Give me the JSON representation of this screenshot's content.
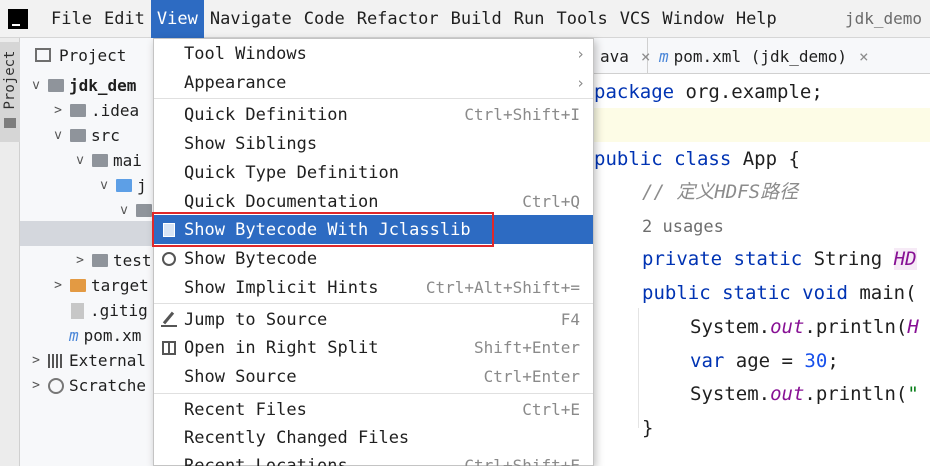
{
  "menubar": {
    "items": [
      "File",
      "Edit",
      "View",
      "Navigate",
      "Code",
      "Refactor",
      "Build",
      "Run",
      "Tools",
      "VCS",
      "Window",
      "Help"
    ],
    "active_index": 2,
    "project_title": "jdk_demo"
  },
  "left_stripe": {
    "project_label": "Project"
  },
  "project_panel": {
    "title": "Project",
    "tree": [
      {
        "label": "jdk_dem",
        "arrow": "v",
        "icon": "folder"
      },
      {
        "label": ".idea",
        "arrow": ">",
        "icon": "folder"
      },
      {
        "label": "src",
        "arrow": "v",
        "icon": "folder"
      },
      {
        "label": "mai",
        "arrow": "v",
        "icon": "folder"
      },
      {
        "label": "j",
        "arrow": "v",
        "icon": "folder-blue"
      },
      {
        "label": "",
        "arrow": "v",
        "icon": "package"
      },
      {
        "label": "",
        "arrow": "",
        "icon": ""
      },
      {
        "label": "test",
        "arrow": ">",
        "icon": "folder"
      },
      {
        "label": "target",
        "arrow": ">",
        "icon": "folder-orange"
      },
      {
        "label": ".gitig",
        "arrow": "",
        "icon": "file"
      },
      {
        "label": "pom.xm",
        "arrow": "",
        "icon": "maven"
      },
      {
        "label": "External",
        "arrow": ">",
        "icon": "libraries"
      },
      {
        "label": "Scratche",
        "arrow": ">",
        "icon": "scratches"
      }
    ]
  },
  "tabs": [
    {
      "label": "ava",
      "close": "×"
    },
    {
      "label": "pom.xml (jdk_demo)",
      "close": "×"
    }
  ],
  "code": {
    "package_kw": "package",
    "package_name": "org.example;",
    "class_decl_kw": "public class",
    "class_name": "App {",
    "comment": "// 定义HDFS路径",
    "usages": "2 usages",
    "field_kw": "private static",
    "field_type": "String",
    "field_name": "HD",
    "main_kw": "public static void",
    "main_name": "main(",
    "line1_prefix": "System.",
    "line1_out": "out",
    "line1_suffix": ".println(",
    "line1_arg": "H",
    "var_kw": "var",
    "var_rest": "age = ",
    "var_value": "30",
    "var_semicolon": ";",
    "line3_prefix": "System.",
    "line3_out": "out",
    "line3_suffix": ".println(",
    "line3_arg": "\"",
    "closing_brace": "}"
  },
  "view_menu": {
    "items": [
      {
        "label": "Tool Windows",
        "shortcut": "",
        "submenu": true
      },
      {
        "label": "Appearance",
        "shortcut": "",
        "submenu": true
      },
      {
        "label": "Quick Definition",
        "shortcut": "Ctrl+Shift+I"
      },
      {
        "label": "Show Siblings",
        "shortcut": ""
      },
      {
        "label": "Quick Type Definition",
        "shortcut": ""
      },
      {
        "label": "Quick Documentation",
        "shortcut": "Ctrl+Q"
      },
      {
        "label": "Show Bytecode With Jclasslib",
        "shortcut": "",
        "icon": "jclasslib-icon",
        "highlighted": true
      },
      {
        "label": "Show Bytecode",
        "shortcut": "",
        "icon": "bytecode-search-icon"
      },
      {
        "label": "Show Implicit Hints",
        "shortcut": "Ctrl+Alt+Shift+="
      },
      {
        "label": "Jump to Source",
        "shortcut": "F4",
        "icon": "jump-to-source-icon"
      },
      {
        "label": "Open in Right Split",
        "shortcut": "Shift+Enter",
        "icon": "split-icon"
      },
      {
        "label": "Show Source",
        "shortcut": "Ctrl+Enter"
      },
      {
        "label": "Recent Files",
        "shortcut": "Ctrl+E"
      },
      {
        "label": "Recently Changed Files",
        "shortcut": ""
      },
      {
        "label": "Recent Locations",
        "shortcut": "Ctrl+Shift+E"
      }
    ],
    "submenu_glyph": "›"
  },
  "colors": {
    "accent": "#2d6bc2",
    "highlight_border": "#e0282a",
    "keyword": "#0033b3",
    "static_field": "#871094",
    "number": "#1750eb"
  }
}
